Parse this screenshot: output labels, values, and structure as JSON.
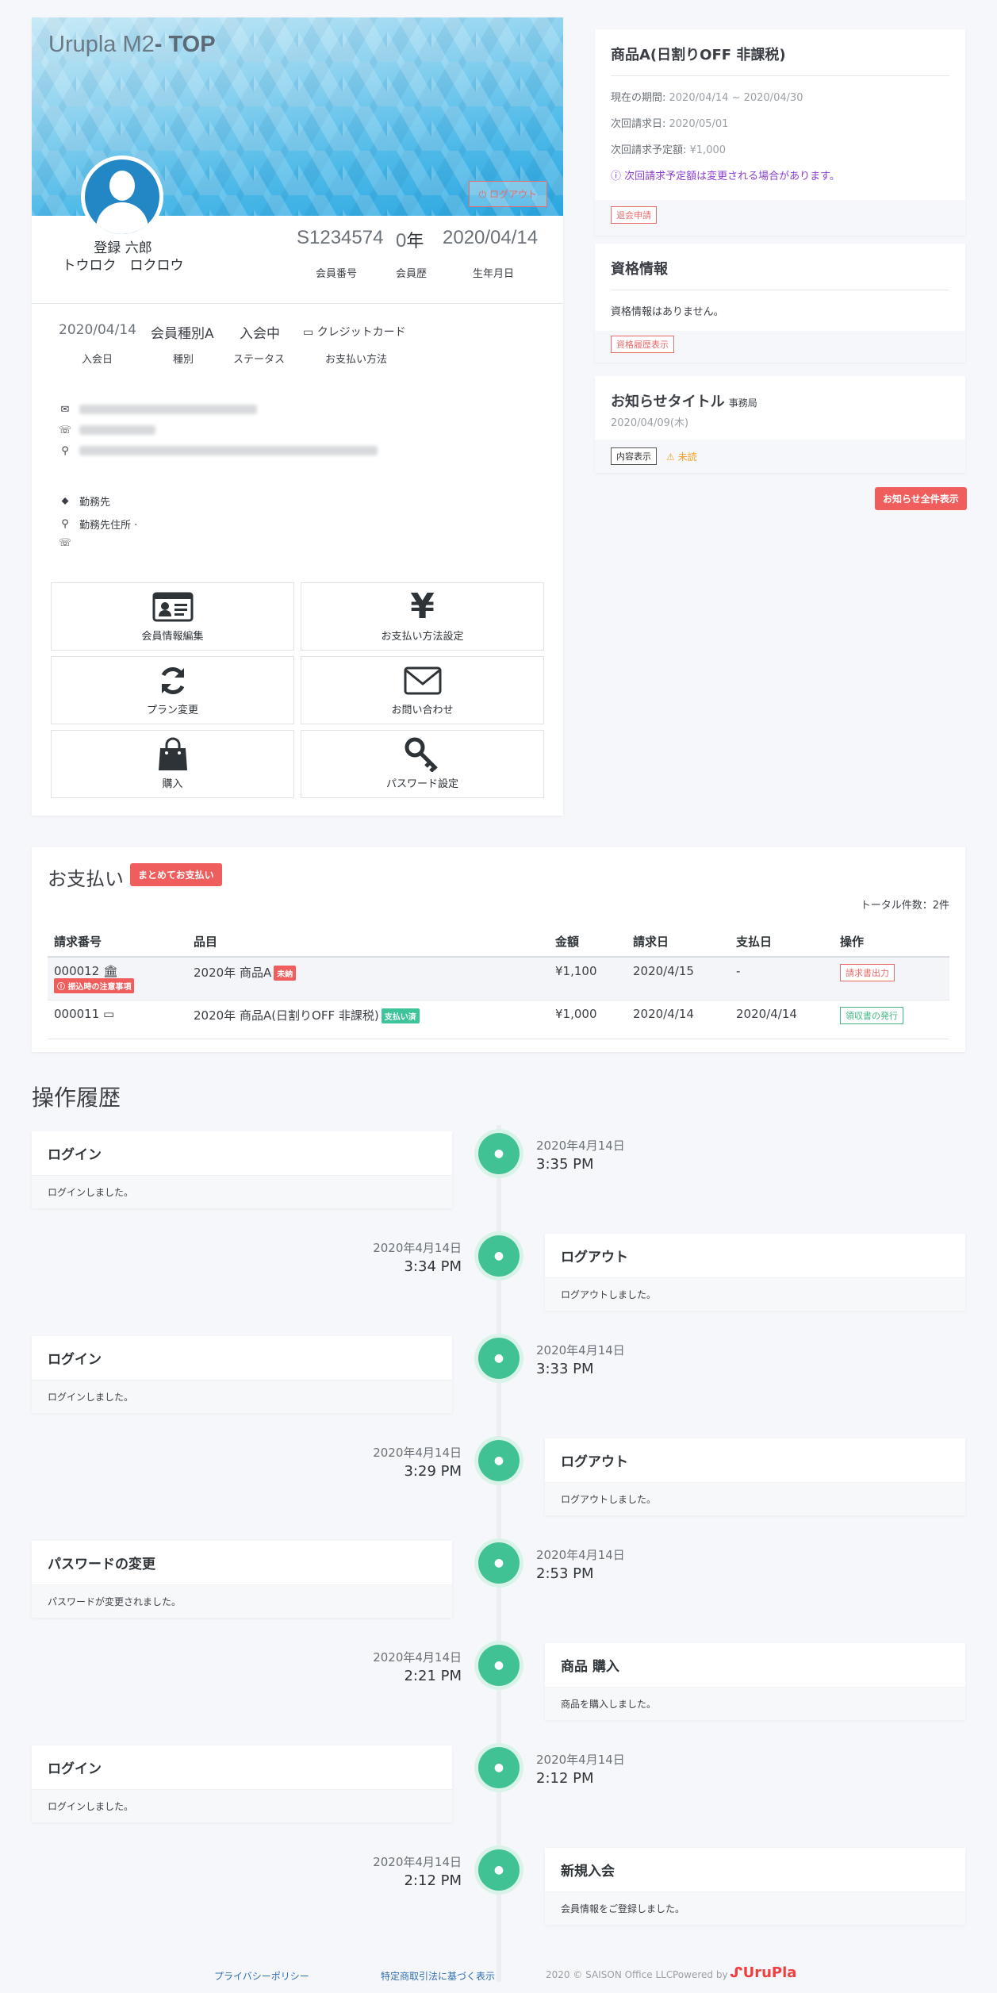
{
  "profile": {
    "app_title_plain": "Urupla M2",
    "app_title_bold": "- TOP",
    "logout_label": "ログアウト",
    "name_kanji": "登録 六郎",
    "name_kana": "トウロク　ロクロウ",
    "stats": [
      {
        "value": "S1234574",
        "label": "会員番号"
      },
      {
        "value": "0",
        "unit": "年",
        "label": "会員歴"
      },
      {
        "value": "2020/04/14",
        "label": "生年月日"
      }
    ],
    "meta": [
      {
        "value": "2020/04/14",
        "label": "入会日"
      },
      {
        "value": "会員種別A",
        "label": "種別"
      },
      {
        "value": "入会中",
        "label": "ステータス"
      },
      {
        "value": "クレジットカード",
        "label": "お支払い方法"
      }
    ],
    "workplace_label": "勤務先",
    "workplace_address_label": "勤務先住所 ·"
  },
  "actions": [
    {
      "label": "会員情報編集",
      "icon": "id-card-icon"
    },
    {
      "label": "お支払い方法設定",
      "icon": "yen-icon"
    },
    {
      "label": "プラン変更",
      "icon": "sync-icon"
    },
    {
      "label": "お問い合わせ",
      "icon": "envelope-icon"
    },
    {
      "label": "購入",
      "icon": "shopping-bag-icon"
    },
    {
      "label": "パスワード設定",
      "icon": "key-icon"
    }
  ],
  "plan": {
    "title": "商品A(日割りOFF 非課税)",
    "period_label": "現在の期間: ",
    "period_value": "2020/04/14 ~ 2020/04/30",
    "next_bill_label": "次回請求日: ",
    "next_bill_value": "2020/05/01",
    "next_amount_label": "次回請求予定額: ",
    "next_amount_value": "¥1,000",
    "notice": "次回請求予定額は変更される場合があります。",
    "withdraw_label": "退会申請"
  },
  "qualification": {
    "title": "資格情報",
    "empty_text": "資格情報はありません。",
    "history_label": "資格履歴表示"
  },
  "news": {
    "title": "お知らせタイトル",
    "sender": "事務局",
    "date": "2020/04/09(木)",
    "view_label": "内容表示",
    "unread_label": "未読",
    "all_label": "お知らせ全件表示"
  },
  "payments": {
    "title": "お支払い",
    "bulk_label": "まとめてお支払い",
    "total_text": "トータル件数：2件",
    "columns": [
      "請求番号",
      "品目",
      "金額",
      "請求日",
      "支払日",
      "操作"
    ],
    "rows": [
      {
        "id": "000012",
        "method_icon": "bank-icon",
        "notice": "振込時の注意事項",
        "item": "2020年 商品A",
        "status": "未納",
        "amount": "¥1,100",
        "billed": "2020/4/15",
        "paid": "-",
        "action": "請求書出力"
      },
      {
        "id": "000011",
        "method_icon": "credit-card-icon",
        "item": "2020年 商品A(日割りOFF 非課税)",
        "status": "支払い済",
        "amount": "¥1,000",
        "billed": "2020/4/14",
        "paid": "2020/4/14",
        "action": "領収書の発行"
      }
    ]
  },
  "history": {
    "title": "操作履歴",
    "events": [
      {
        "side": "left",
        "title": "ログイン",
        "desc": "ログインしました。",
        "date": "2020年4月14日",
        "time": "3:35 PM"
      },
      {
        "side": "right",
        "title": "ログアウト",
        "desc": "ログアウトしました。",
        "date": "2020年4月14日",
        "time": "3:34 PM"
      },
      {
        "side": "left",
        "title": "ログイン",
        "desc": "ログインしました。",
        "date": "2020年4月14日",
        "time": "3:33 PM"
      },
      {
        "side": "right",
        "title": "ログアウト",
        "desc": "ログアウトしました。",
        "date": "2020年4月14日",
        "time": "3:29 PM"
      },
      {
        "side": "left",
        "title": "パスワードの変更",
        "desc": "パスワードが変更されました。",
        "date": "2020年4月14日",
        "time": "2:53 PM"
      },
      {
        "side": "right",
        "title": "商品 購入",
        "desc": "商品を購入しました。",
        "date": "2020年4月14日",
        "time": "2:21 PM"
      },
      {
        "side": "left",
        "title": "ログイン",
        "desc": "ログインしました。",
        "date": "2020年4月14日",
        "time": "2:12 PM"
      },
      {
        "side": "right",
        "title": "新規入会",
        "desc": "会員情報をご登録しました。",
        "date": "2020年4月14日",
        "time": "2:12 PM"
      }
    ]
  },
  "footer": {
    "privacy": "プライバシーポリシー",
    "commerce": "特定商取引法に基づく表示",
    "copyright": "2020 © SAISON Office LLC.",
    "powered_by": "Powered by",
    "brand": "UruPla"
  },
  "colors": {
    "accent_red": "#ef5d5d",
    "accent_green": "#41c295",
    "notice_purple": "#8a3fd1",
    "warning_orange": "#f0a020"
  }
}
